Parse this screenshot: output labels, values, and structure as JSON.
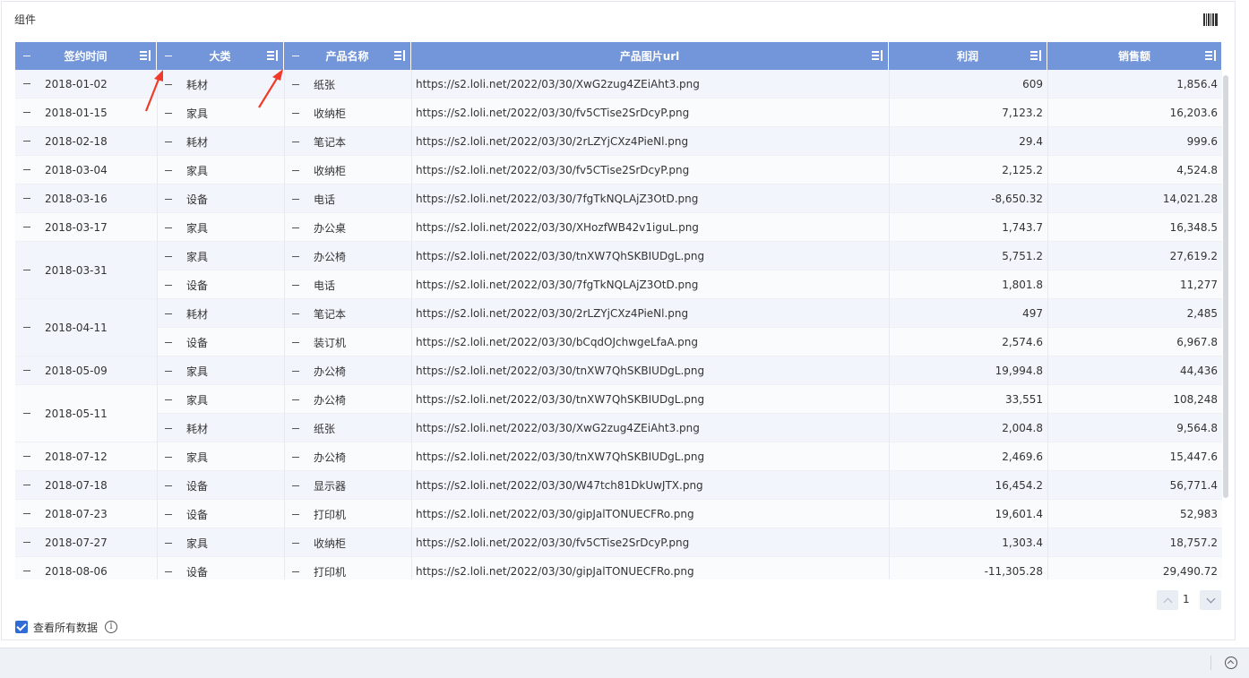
{
  "panel": {
    "title": "组件",
    "barcode_icon": "barcode-icon"
  },
  "table": {
    "columns": [
      {
        "label": "签约时间",
        "sort_icon": "sort-asc-icon"
      },
      {
        "label": "大类",
        "sort_icon": "sort-asc-icon"
      },
      {
        "label": "产品名称",
        "sort_icon": "sort-asc-icon"
      },
      {
        "label": "产品图片url",
        "sort_icon": "sort-asc-icon"
      },
      {
        "label": "利润",
        "sort_icon": "sort-both-icon"
      },
      {
        "label": "销售额",
        "sort_icon": "sort-both-icon"
      }
    ],
    "rows": [
      {
        "date": "2018-01-02",
        "category": "耗材",
        "product": "纸张",
        "url": "https://s2.loli.net/2022/03/30/XwG2zug4ZEiAht3.png",
        "profit": "609",
        "sales": "1,856.4"
      },
      {
        "date": "2018-01-15",
        "category": "家具",
        "product": "收纳柜",
        "url": "https://s2.loli.net/2022/03/30/fv5CTise2SrDcyP.png",
        "profit": "7,123.2",
        "sales": "16,203.6"
      },
      {
        "date": "2018-02-18",
        "category": "耗材",
        "product": "笔记本",
        "url": "https://s2.loli.net/2022/03/30/2rLZYjCXz4PieNl.png",
        "profit": "29.4",
        "sales": "999.6"
      },
      {
        "date": "2018-03-04",
        "category": "家具",
        "product": "收纳柜",
        "url": "https://s2.loli.net/2022/03/30/fv5CTise2SrDcyP.png",
        "profit": "2,125.2",
        "sales": "4,524.8"
      },
      {
        "date": "2018-03-16",
        "category": "设备",
        "product": "电话",
        "url": "https://s2.loli.net/2022/03/30/7fgTkNQLAjZ3OtD.png",
        "profit": "-8,650.32",
        "sales": "14,021.28"
      },
      {
        "date": "2018-03-17",
        "category": "家具",
        "product": "办公桌",
        "url": "https://s2.loli.net/2022/03/30/XHozfWB42v1iguL.png",
        "profit": "1,743.7",
        "sales": "16,348.5"
      },
      {
        "date": "2018-03-31",
        "category": "家具",
        "product": "办公椅",
        "url": "https://s2.loli.net/2022/03/30/tnXW7QhSKBIUDgL.png",
        "profit": "5,751.2",
        "sales": "27,619.2"
      },
      {
        "date": "",
        "category": "设备",
        "product": "电话",
        "url": "https://s2.loli.net/2022/03/30/7fgTkNQLAjZ3OtD.png",
        "profit": "1,801.8",
        "sales": "11,277"
      },
      {
        "date": "2018-04-11",
        "category": "耗材",
        "product": "笔记本",
        "url": "https://s2.loli.net/2022/03/30/2rLZYjCXz4PieNl.png",
        "profit": "497",
        "sales": "2,485"
      },
      {
        "date": "",
        "category": "设备",
        "product": "装订机",
        "url": "https://s2.loli.net/2022/03/30/bCqdOJchwgeLfaA.png",
        "profit": "2,574.6",
        "sales": "6,967.8"
      },
      {
        "date": "2018-05-09",
        "category": "家具",
        "product": "办公椅",
        "url": "https://s2.loli.net/2022/03/30/tnXW7QhSKBIUDgL.png",
        "profit": "19,994.8",
        "sales": "44,436"
      },
      {
        "date": "2018-05-11",
        "category": "家具",
        "product": "办公椅",
        "url": "https://s2.loli.net/2022/03/30/tnXW7QhSKBIUDgL.png",
        "profit": "33,551",
        "sales": "108,248"
      },
      {
        "date": "",
        "category": "耗材",
        "product": "纸张",
        "url": "https://s2.loli.net/2022/03/30/XwG2zug4ZEiAht3.png",
        "profit": "2,004.8",
        "sales": "9,564.8"
      },
      {
        "date": "2018-07-12",
        "category": "家具",
        "product": "办公椅",
        "url": "https://s2.loli.net/2022/03/30/tnXW7QhSKBIUDgL.png",
        "profit": "2,469.6",
        "sales": "15,447.6"
      },
      {
        "date": "2018-07-18",
        "category": "设备",
        "product": "显示器",
        "url": "https://s2.loli.net/2022/03/30/W47tch81DkUwJTX.png",
        "profit": "16,454.2",
        "sales": "56,771.4"
      },
      {
        "date": "2018-07-23",
        "category": "设备",
        "product": "打印机",
        "url": "https://s2.loli.net/2022/03/30/gipJalTONUECFRo.png",
        "profit": "19,601.4",
        "sales": "52,983"
      },
      {
        "date": "2018-07-27",
        "category": "家具",
        "product": "收纳柜",
        "url": "https://s2.loli.net/2022/03/30/fv5CTise2SrDcyP.png",
        "profit": "1,303.4",
        "sales": "18,757.2"
      },
      {
        "date": "2018-08-06",
        "category": "设备",
        "product": "打印机",
        "url": "https://s2.loli.net/2022/03/30/gipJalTONUECFRo.png",
        "profit": "-11,305.28",
        "sales": "29,490.72"
      }
    ]
  },
  "pagination": {
    "current_page": "1",
    "prev_icon": "chevron-up-icon",
    "next_icon": "chevron-down-icon"
  },
  "footer": {
    "show_all_label": "查看所有数据",
    "show_all_checked": true,
    "info_icon": "info-icon",
    "collapse_icon": "collapse-up-icon"
  },
  "colors": {
    "header_bg": "#7296d9",
    "row_even": "#f2f5fb",
    "row_odd": "#fafbfd",
    "checkbox": "#2f6cd6",
    "annotation_arrow": "#f03b2a"
  }
}
